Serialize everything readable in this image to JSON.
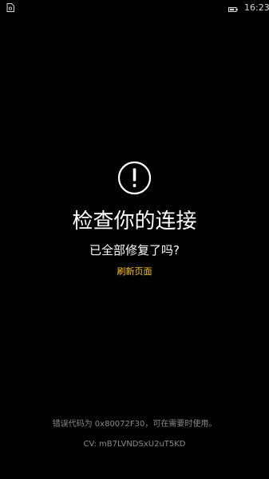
{
  "status_bar": {
    "time": "16:23",
    "left_icon": "sim-card-icon",
    "battery_icon": "battery-icon"
  },
  "error": {
    "icon": "warning-circle-icon",
    "title": "检查你的连接",
    "subtitle": "已全部修复了吗?",
    "refresh_label": "刷新页面"
  },
  "footer": {
    "error_code_text": "错误代码为 0x80072F30，可在需要时使用。",
    "cv_text": "CV: mB7LVNDSxU2uT5KD"
  },
  "colors": {
    "background": "#000000",
    "text": "#ffffff",
    "link": "#f5c518",
    "muted": "#8a8a8a"
  }
}
